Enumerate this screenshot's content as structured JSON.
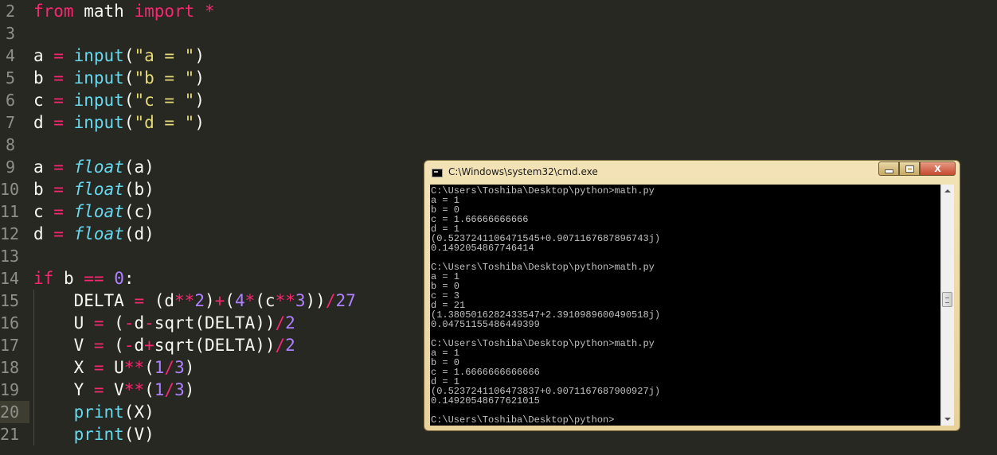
{
  "editor": {
    "lines": [
      {
        "num": "2"
      },
      {
        "num": "3"
      },
      {
        "num": "4"
      },
      {
        "num": "5"
      },
      {
        "num": "6"
      },
      {
        "num": "7"
      },
      {
        "num": "8"
      },
      {
        "num": "9"
      },
      {
        "num": "10"
      },
      {
        "num": "11"
      },
      {
        "num": "12"
      },
      {
        "num": "13"
      },
      {
        "num": "14"
      },
      {
        "num": "15"
      },
      {
        "num": "16"
      },
      {
        "num": "17"
      },
      {
        "num": "18"
      },
      {
        "num": "19"
      },
      {
        "num": "20"
      },
      {
        "num": "21"
      }
    ],
    "t": {
      "l2_from": "from",
      "l2_math": " math ",
      "l2_import": "import",
      "l2_star": " *",
      "l4_a": "a ",
      "l4_eq": "=",
      "l4_input": " input",
      "l4_open": "(",
      "l4_str": "\"a = \"",
      "l4_close": ")",
      "l5_a": "b ",
      "l5_eq": "=",
      "l5_input": " input",
      "l5_open": "(",
      "l5_str": "\"b = \"",
      "l5_close": ")",
      "l6_a": "c ",
      "l6_eq": "=",
      "l6_input": " input",
      "l6_open": "(",
      "l6_str": "\"c = \"",
      "l6_close": ")",
      "l7_a": "d ",
      "l7_eq": "=",
      "l7_input": " input",
      "l7_open": "(",
      "l7_str": "\"d = \"",
      "l7_close": ")",
      "l9_a": "a ",
      "l9_eq": "=",
      "l9_float": " float",
      "l9_arg": "(a)",
      "l10_a": "b ",
      "l10_eq": "=",
      "l10_float": " float",
      "l10_arg": "(b)",
      "l11_a": "c ",
      "l11_eq": "=",
      "l11_float": " float",
      "l11_arg": "(c)",
      "l12_a": "d ",
      "l12_eq": "=",
      "l12_float": " float",
      "l12_arg": "(d)",
      "l14_if": "if",
      "l14_b": " b ",
      "l14_eqeq": "==",
      "l14_sp": " ",
      "l14_zero": "0",
      "l14_colon": ":",
      "l15_a": "    DELTA ",
      "l15_eq": "=",
      "l15_b": " (d",
      "l15_pow": "**",
      "l15_two": "2",
      "l15_c": ")",
      "l15_plus": "+",
      "l15_d": "(",
      "l15_four": "4",
      "l15_mul": "*",
      "l15_e": "(c",
      "l15_pow2": "**",
      "l15_three": "3",
      "l15_f": "))",
      "l15_div": "/",
      "l15_27": "27",
      "l16_a": "    U ",
      "l16_eq": "=",
      "l16_b": " (",
      "l16_minus": "-",
      "l16_c": "d",
      "l16_minus2": "-",
      "l16_sqrt": "sqrt",
      "l16_d": "(DELTA))",
      "l16_div": "/",
      "l16_two": "2",
      "l17_a": "    V ",
      "l17_eq": "=",
      "l17_b": " (",
      "l17_minus": "-",
      "l17_c": "d",
      "l17_plus": "+",
      "l17_sqrt": "sqrt",
      "l17_d": "(DELTA))",
      "l17_div": "/",
      "l17_two": "2",
      "l18_a": "    X ",
      "l18_eq": "=",
      "l18_b": " U",
      "l18_pow": "**",
      "l18_c": "(",
      "l18_one": "1",
      "l18_div": "/",
      "l18_three": "3",
      "l18_d": ")",
      "l19_a": "    Y ",
      "l19_eq": "=",
      "l19_b": " V",
      "l19_pow": "**",
      "l19_c": "(",
      "l19_one": "1",
      "l19_div": "/",
      "l19_three": "3",
      "l19_d": ")",
      "l20_a": "    ",
      "l20_print": "print",
      "l20_b": "(X)",
      "l21_a": "    ",
      "l21_print": "print",
      "l21_b": "(V)"
    }
  },
  "cmd_window": {
    "title": "C:\\Windows\\system32\\cmd.exe",
    "close_label": "X",
    "output": "C:\\Users\\Toshiba\\Desktop\\python>math.py\na = 1\nb = 0\nc = 1.66666666666\nd = 1\n(0.5237241106471545+0.9071167687896743j)\n0.1492054867746414\n\nC:\\Users\\Toshiba\\Desktop\\python>math.py\na = 1\nb = 0\nc = 3\nd = 21\n(1.3805016282433547+2.3910989600490518j)\n0.04751155486449399\n\nC:\\Users\\Toshiba\\Desktop\\python>math.py\na = 1\nb = 0\nc = 1.6666666666666\nd = 1\n(0.5237241106473837+0.9071167687900927j)\n0.14920548677621015\n\nC:\\Users\\Toshiba\\Desktop\\python>"
  },
  "colors": {
    "editor_bg": "#272822",
    "keyword": "#f92672",
    "function": "#66d9ef",
    "string": "#e6db74",
    "number": "#ae81ff",
    "text": "#f8f8f2",
    "console_text": "#c0c0c0"
  }
}
